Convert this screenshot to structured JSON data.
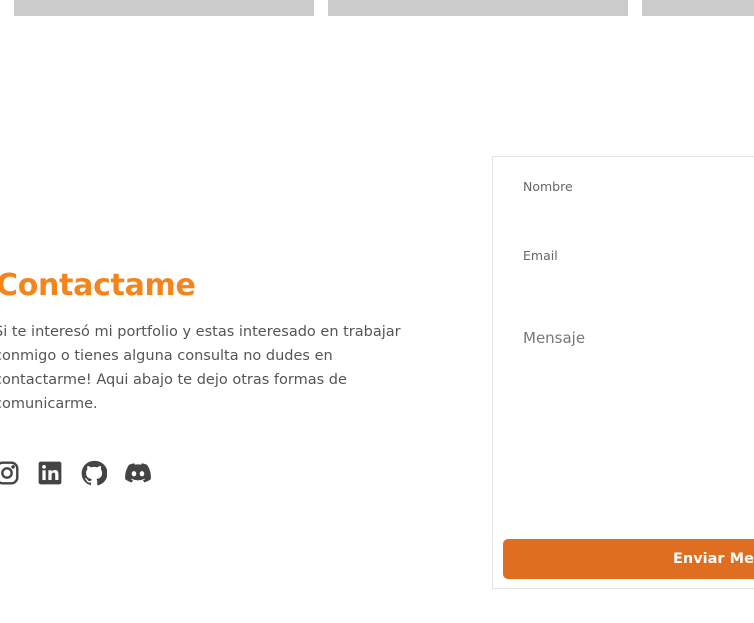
{
  "contact": {
    "title": "Contactame",
    "description_lines": [
      "Si te interesó mi portfolio y estas interesado en trabajar",
      "conmigo o tienes alguna consulta no dudes en",
      "contactarme! Aqui abajo te dejo otras formas de",
      "comunicarme."
    ]
  },
  "social": [
    {
      "icon": "instagram-icon"
    },
    {
      "icon": "linkedin-icon"
    },
    {
      "icon": "github-icon"
    },
    {
      "icon": "discord-icon"
    }
  ],
  "form": {
    "nombre_label": "Nombre",
    "email_label": "Email",
    "mensaje_placeholder": "Mensaje",
    "submit_label": "Enviar Mensaje"
  },
  "colors": {
    "accent": "#f5841b",
    "button": "#e06e21",
    "icon": "#444444"
  }
}
